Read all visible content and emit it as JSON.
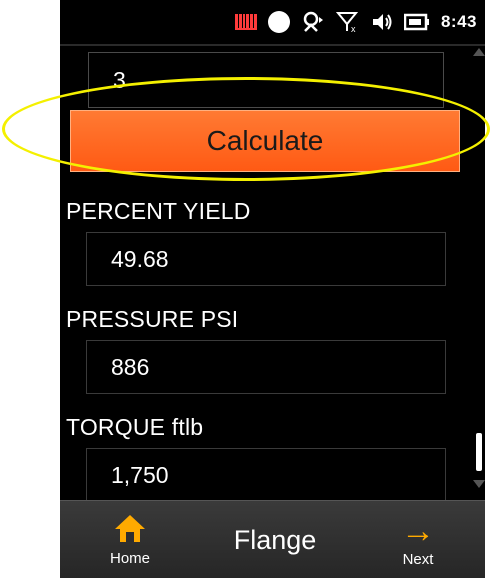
{
  "status_bar": {
    "time": "8:43",
    "icons": [
      "signal-bars-icon",
      "dot-icon",
      "sync-icon",
      "no-signal-icon",
      "speaker-icon",
      "battery-icon"
    ]
  },
  "form": {
    "input_value": "3",
    "calculate_label": "Calculate",
    "percent_yield_label": "PERCENT YIELD",
    "percent_yield_value": "49.68",
    "pressure_label": "PRESSURE PSI",
    "pressure_value": "886",
    "torque_label": "TORQUE ftlb",
    "torque_value": "1,750"
  },
  "bottom_bar": {
    "home_label": "Home",
    "title": "Flange",
    "next_label": "Next"
  },
  "colors": {
    "accent": "#ff6a1f",
    "highlight": "#f4f000",
    "home_icon": "#ffaa00",
    "background": "#000000"
  }
}
